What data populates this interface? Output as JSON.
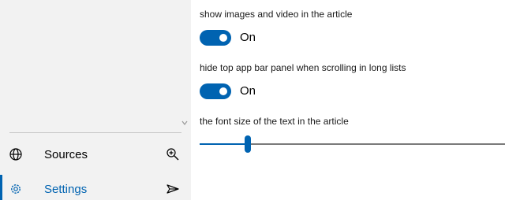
{
  "nav": {
    "items": [
      {
        "label": "Sources",
        "icon": "globe-icon",
        "action_icon": "zoom-in-icon"
      },
      {
        "label": "Settings",
        "icon": "gear-icon",
        "action_icon": "send-icon",
        "selected": true
      }
    ]
  },
  "settings": {
    "show_media": {
      "label": "show images and video in the article",
      "state": "On",
      "on": true
    },
    "hide_app_bar": {
      "label": "hide top app bar panel when scrolling in long lists",
      "state": "On",
      "on": true
    },
    "font_size": {
      "label": "the font size of the text in the article",
      "value_fraction": 0.15
    }
  },
  "colors": {
    "accent": "#0063b1",
    "sidebar_bg": "#f2f2f2",
    "track": "#7a7a7a"
  }
}
